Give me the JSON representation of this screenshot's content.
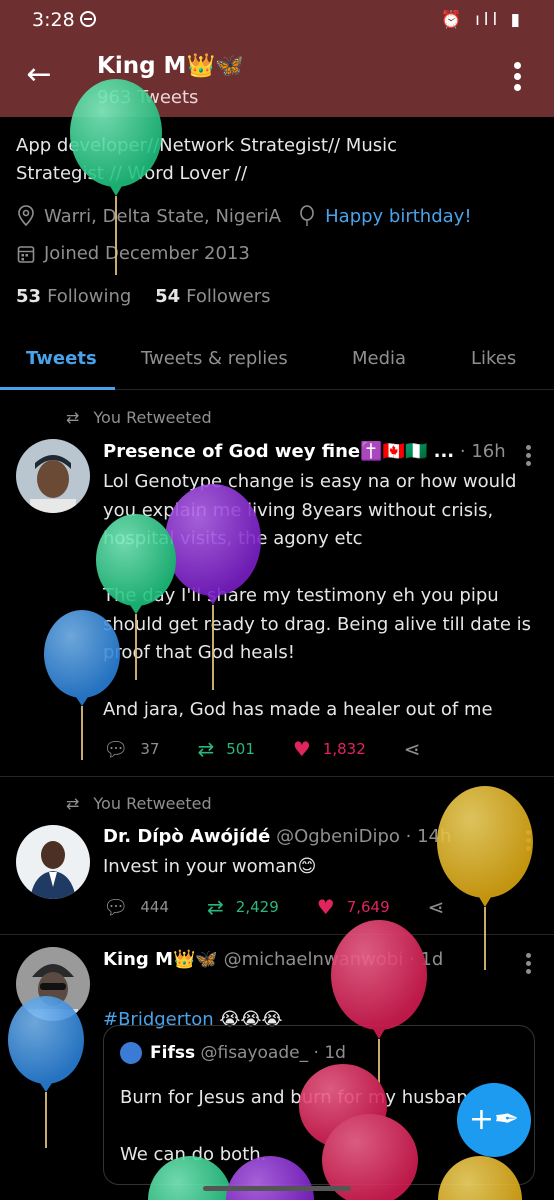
{
  "status_bar": {
    "time": "3:28",
    "icons": "⏰ ıll ▮"
  },
  "header": {
    "back_icon": "←",
    "name": "King M👑🦋",
    "tweet_count": "963 Tweets"
  },
  "profile": {
    "bio_line1": "App developer//Network Strategist// Music",
    "bio_line2": "Strategist // Word Lover //",
    "location": "Warri, Delta State, NigeriA",
    "birthday_link": "Happy birthday!",
    "joined": "Joined December 2013",
    "following_count": "53",
    "following_label": "Following",
    "followers_count": "54",
    "followers_label": "Followers"
  },
  "tabs": [
    "Tweets",
    "Tweets & replies",
    "Media",
    "Likes"
  ],
  "tweets": [
    {
      "retweet_label": "You Retweeted",
      "name": "Presence of God wey fine✝️🇨🇦🇳🇬 ...",
      "time": "· 16h",
      "text": "Lol Genotype change is easy na or how would you explain me living 8years without crisis, hospital visits, the agony etc\n\nThe day I'll share my testimony eh you pipu should get ready to drag. Being alive till date is proof that God heals!\n\nAnd jara, God has made a healer out of me",
      "replies": "37",
      "retweets": "501",
      "likes": "1,832"
    },
    {
      "retweet_label": "You Retweeted",
      "name": "Dr. Dípò Awójídé",
      "handle": "@OgbeniDipo",
      "time": "· 14h",
      "text": "Invest in your woman😊",
      "replies": "444",
      "retweets": "2,429",
      "likes": "7,649"
    },
    {
      "name": "King M👑🦋",
      "handle": "@michaelnwanwobi",
      "time": "· 1d",
      "hashtag": "#Bridgerton",
      "emojis": "😭😭😭",
      "quote": {
        "name": "Fifss",
        "handle": "@fisayoade_",
        "time": "· 1d",
        "text": "Burn for Jesus and burn for my husband\n\nWe can do both."
      }
    }
  ],
  "fab_icon": "+✒",
  "balloon_colors": {
    "green": "#2fd08f",
    "purple": "#8c2cd6",
    "blue": "#3a8fe0",
    "yellow": "#e8b826",
    "red": "#e3275c"
  }
}
